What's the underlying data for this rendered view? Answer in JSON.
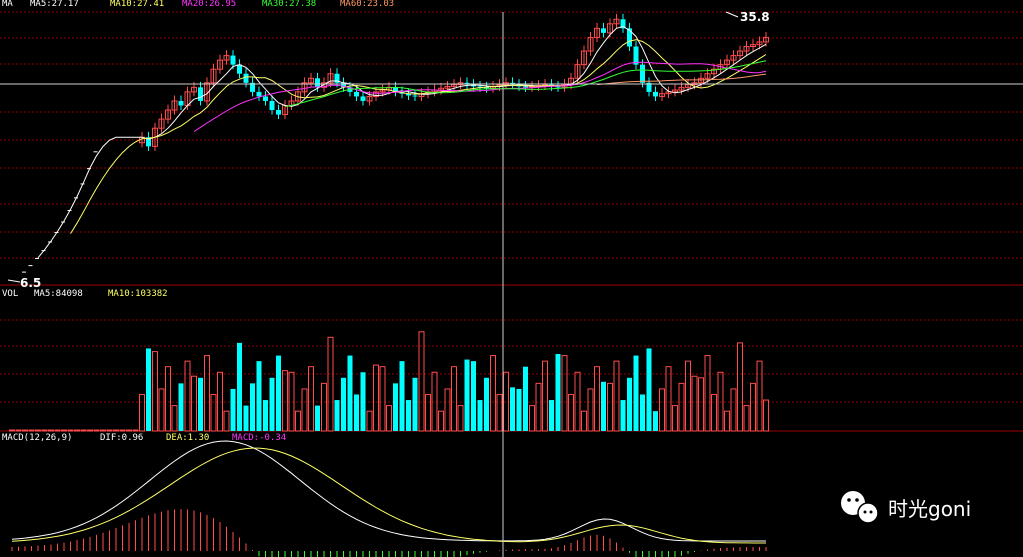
{
  "colors": {
    "up": "#ff4d4d",
    "down": "#00ffff",
    "grid": "#8b0000",
    "ma5": "#ffffff",
    "ma10": "#ffff66",
    "ma20": "#ff33ff",
    "ma30": "#33ff33",
    "ma60": "#ff9966",
    "dif": "#ffffff",
    "dea": "#ffff66",
    "macd": "#ff33ff"
  },
  "header": {
    "ma_name": "MA",
    "ma5": "MA5:27.17",
    "ma10": "MA10:27.41",
    "ma20": "MA20:26.95",
    "ma30": "MA30:27.38",
    "ma60": "MA60:23.03",
    "vol_name": "VOL",
    "vol_ma5": "MA5:84098",
    "vol_ma10": "MA10:103382",
    "macd_name": "MACD(12,26,9)",
    "dif": "DIF:0.96",
    "dea": "DEA:1.30",
    "macd": "MACD:-0.34"
  },
  "annotations": {
    "high": "35.8",
    "low": "6.5"
  },
  "watermark": {
    "text": "时光goni",
    "icon": "wechat-icon"
  },
  "chart_data": [
    {
      "type": "candlestick",
      "panel": "price",
      "high_annotation": 35.8,
      "low_annotation": 6.5,
      "series": [
        {
          "name": "MA5",
          "last": 27.17
        },
        {
          "name": "MA10",
          "last": 27.41
        },
        {
          "name": "MA20",
          "last": 26.95
        },
        {
          "name": "MA30",
          "last": 27.38
        },
        {
          "name": "MA60",
          "last": 23.03
        }
      ]
    },
    {
      "type": "bar",
      "panel": "volume",
      "series": [
        {
          "name": "MA5",
          "last": 84098
        },
        {
          "name": "MA10",
          "last": 103382
        }
      ]
    },
    {
      "type": "line",
      "panel": "macd",
      "params": "12,26,9",
      "series": [
        {
          "name": "DIF",
          "last": 0.96
        },
        {
          "name": "DEA",
          "last": 1.3
        },
        {
          "name": "MACD",
          "last": -0.34
        }
      ]
    }
  ]
}
